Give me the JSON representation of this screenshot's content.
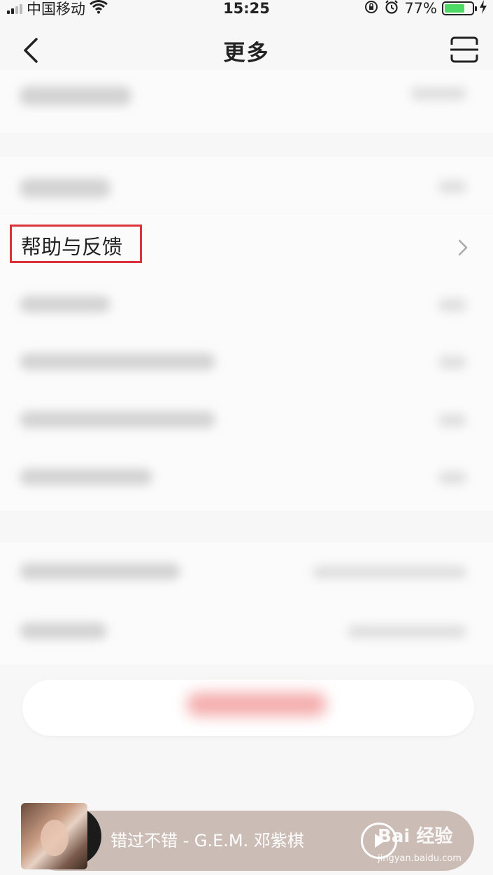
{
  "status_bar": {
    "carrier": "中国移动",
    "time": "15:25",
    "battery_percent": "77%",
    "battery_level": 0.77,
    "icons": [
      "signal-icon",
      "wifi-icon",
      "rotation-lock-icon",
      "alarm-icon",
      "battery-icon",
      "charging-icon"
    ]
  },
  "nav": {
    "title": "更多",
    "back_icon": "back-chevron-icon",
    "scan_icon": "scan-icon"
  },
  "list": {
    "help_feedback_label": "帮助与反馈",
    "chevron_icon": "chevron-right-icon"
  },
  "player": {
    "song": "错过不错 - G.E.M. 邓紫棋",
    "watermark": "Bai 经验",
    "watermark_url": "jingyan.baidu.com"
  },
  "colors": {
    "highlight": "#d9323a",
    "battery": "#4cd964",
    "player_bg": "#cbbdb6"
  }
}
